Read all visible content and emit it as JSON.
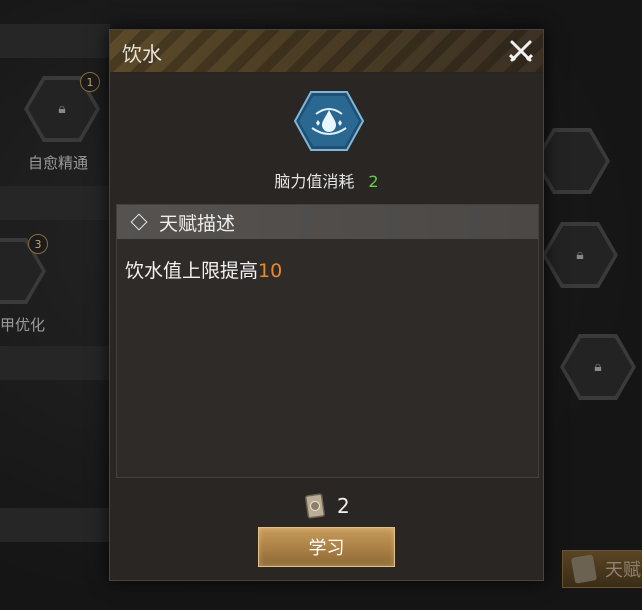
{
  "background": {
    "talents": [
      {
        "label": "自愈精通",
        "badge": "1"
      },
      {
        "label": "甲优化",
        "badge": "3"
      }
    ],
    "corner_tab_label": "天赋"
  },
  "dialog": {
    "title": "饮水",
    "skill_icon": "water-drop-hex-icon",
    "cost_label": "脑力值消耗",
    "cost_value": "2",
    "section_title": "天赋描述",
    "description_prefix": "饮水值上限提高",
    "description_value": "10",
    "item_icon": "talent-card-icon",
    "item_qty": "2",
    "learn_label": "学习"
  },
  "colors": {
    "accent_gold": "#b48a4f",
    "value_green": "#5fd04a",
    "value_orange": "#e98a2b"
  }
}
